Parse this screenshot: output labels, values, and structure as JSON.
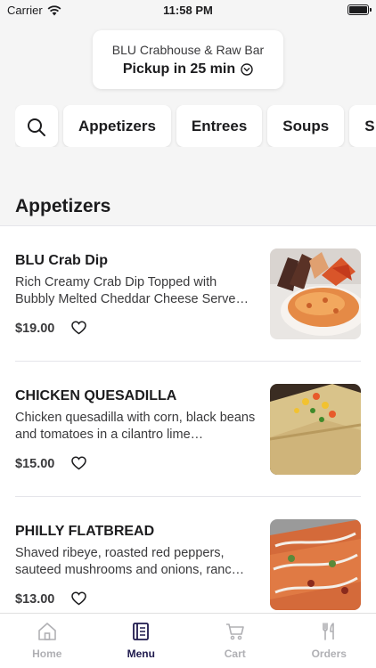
{
  "status": {
    "carrier": "Carrier",
    "time": "11:58 PM"
  },
  "store": {
    "name": "BLU Crabhouse & Raw Bar",
    "pickup": "Pickup in 25 min"
  },
  "categories": [
    "Appetizers",
    "Entrees",
    "Soups",
    "S"
  ],
  "section": {
    "title": "Appetizers"
  },
  "items": [
    {
      "name": "BLU Crab Dip",
      "desc": "Rich Creamy Crab Dip Topped with Bubbly Melted Cheddar Cheese Serve…",
      "price": "$19.00"
    },
    {
      "name": "CHICKEN QUESADILLA",
      "desc": "Chicken quesadilla with corn, black beans and tomatoes in a cilantro lime…",
      "price": "$15.00"
    },
    {
      "name": "PHILLY FLATBREAD",
      "desc": "Shaved ribeye, roasted red peppers, sauteed mushrooms and onions, ranc…",
      "price": "$13.00"
    }
  ],
  "tabs": [
    {
      "label": "Home",
      "icon": "home-icon",
      "active": false
    },
    {
      "label": "Menu",
      "icon": "menu-book-icon",
      "active": true
    },
    {
      "label": "Cart",
      "icon": "cart-icon",
      "active": false
    },
    {
      "label": "Orders",
      "icon": "fork-knife-icon",
      "active": false
    }
  ],
  "colors": {
    "active_tab": "#1f1a4d",
    "inactive_tab": "#b0b0b4",
    "background": "#f5f5f5"
  }
}
